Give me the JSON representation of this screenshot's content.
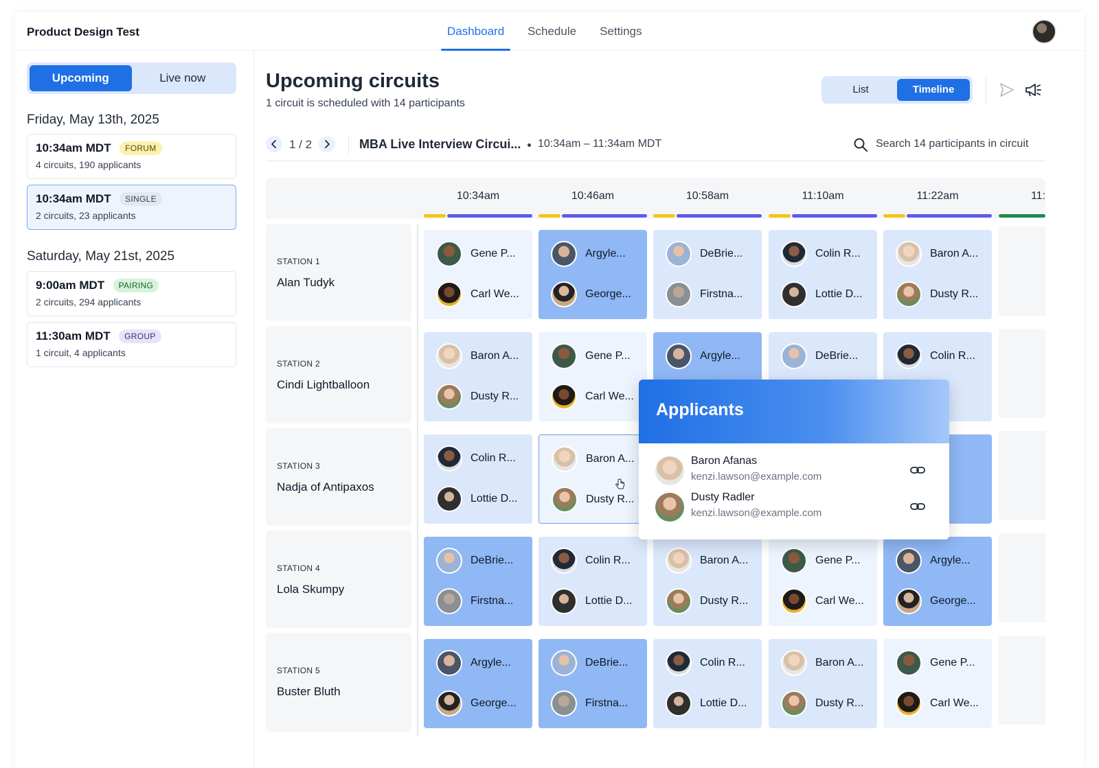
{
  "app": {
    "title": "Product Design Test"
  },
  "nav": {
    "tabs": [
      "Dashboard",
      "Schedule",
      "Settings"
    ],
    "active": "Dashboard"
  },
  "sidebar": {
    "segments": [
      "Upcoming",
      "Live now"
    ],
    "active_segment": "Upcoming",
    "days": [
      {
        "heading": "Friday, May 13th, 2025",
        "slots": [
          {
            "time": "10:34am MDT",
            "badge": "FORUM",
            "summary": "4 circuits, 190 applicants"
          },
          {
            "time": "10:34am MDT",
            "badge": "SINGLE",
            "summary": "2 circuits, 23 applicants",
            "selected": true
          }
        ]
      },
      {
        "heading": "Saturday, May 21st, 2025",
        "slots": [
          {
            "time": "9:00am MDT",
            "badge": "PAIRING",
            "summary": "2 circuits, 294 applicants"
          },
          {
            "time": "11:30am MDT",
            "badge": "GROUP",
            "summary": "1 circuit, 4 applicants"
          }
        ]
      }
    ]
  },
  "main": {
    "title": "Upcoming circuits",
    "subtitle": "1 circuit is scheduled with 14 participants",
    "view_options": [
      "List",
      "Timeline"
    ],
    "active_view": "Timeline",
    "pagination": "1 / 2",
    "circuit_name": "MBA Live Interview Circui...",
    "circuit_time": "10:34am – 11:34am MDT",
    "search_placeholder": "Search 14 participants in circuit",
    "time_slots": [
      "10:34am",
      "10:46am",
      "10:58am",
      "11:10am",
      "11:22am",
      "11:"
    ],
    "stations": [
      {
        "num": "STATION 1",
        "name": "Alan Tudyk"
      },
      {
        "num": "STATION 2",
        "name": "Cindi Lightballoon"
      },
      {
        "num": "STATION 3",
        "name": "Nadja of Antipaxos"
      },
      {
        "num": "STATION 4",
        "name": "Lola Skumpy"
      },
      {
        "num": "STATION 5",
        "name": "Buster Bluth"
      }
    ],
    "cells": [
      [
        {
          "shade": "light",
          "people": [
            "Gene P...",
            "Carl We..."
          ]
        },
        {
          "shade": "dark",
          "people": [
            "Argyle...",
            "George..."
          ]
        },
        {
          "shade": "mid",
          "people": [
            "DeBrie...",
            "Firstna..."
          ]
        },
        {
          "shade": "mid",
          "people": [
            "Colin R...",
            "Lottie D..."
          ]
        },
        {
          "shade": "mid",
          "people": [
            "Baron A...",
            "Dusty R..."
          ]
        }
      ],
      [
        {
          "shade": "mid",
          "people": [
            "Baron A...",
            "Dusty R..."
          ]
        },
        {
          "shade": "light",
          "people": [
            "Gene P...",
            "Carl We..."
          ]
        },
        {
          "shade": "dark",
          "people": [
            "Argyle...",
            ""
          ]
        },
        {
          "shade": "mid",
          "people": [
            "DeBrie...",
            ""
          ]
        },
        {
          "shade": "mid",
          "people": [
            "Colin R...",
            "ttie D..."
          ]
        }
      ],
      [
        {
          "shade": "mid",
          "people": [
            "Colin R...",
            "Lottie D..."
          ]
        },
        {
          "shade": "outlined",
          "people": [
            "Baron A...",
            "Dusty R..."
          ]
        },
        {
          "shade": "mid",
          "people": [
            "",
            ""
          ]
        },
        {
          "shade": "mid",
          "people": [
            "",
            ""
          ]
        },
        {
          "shade": "dark",
          "people": [
            "Brie...",
            "tna..."
          ]
        }
      ],
      [
        {
          "shade": "dark",
          "people": [
            "DeBrie...",
            "Firstna..."
          ]
        },
        {
          "shade": "mid",
          "people": [
            "Colin R...",
            "Lottie D..."
          ]
        },
        {
          "shade": "mid",
          "people": [
            "Baron A...",
            "Dusty R..."
          ]
        },
        {
          "shade": "light",
          "people": [
            "Gene P...",
            "Carl We..."
          ]
        },
        {
          "shade": "dark",
          "people": [
            "Argyle...",
            "George..."
          ]
        }
      ],
      [
        {
          "shade": "dark",
          "people": [
            "Argyle...",
            "George..."
          ]
        },
        {
          "shade": "dark",
          "people": [
            "DeBrie...",
            "Firstna..."
          ]
        },
        {
          "shade": "mid",
          "people": [
            "Colin R...",
            "Lottie D..."
          ]
        },
        {
          "shade": "mid",
          "people": [
            "Baron A...",
            "Dusty R..."
          ]
        },
        {
          "shade": "light",
          "people": [
            "Gene P...",
            "Carl We..."
          ]
        }
      ]
    ]
  },
  "popover": {
    "title": "Applicants",
    "applicants": [
      {
        "name": "Baron Afanas",
        "email": "kenzi.lawson@example.com"
      },
      {
        "name": "Dusty Radler",
        "email": "kenzi.lawson@example.com"
      }
    ]
  },
  "colors": {
    "accent": "#1f6fe5",
    "cell_light": "#eef4fd",
    "cell_mid": "#dbe7fb",
    "cell_dark": "#8fb8f5"
  },
  "icons": [
    "chevron-left-icon",
    "chevron-right-icon",
    "search-icon",
    "send-icon",
    "megaphone-icon",
    "link-icon"
  ]
}
